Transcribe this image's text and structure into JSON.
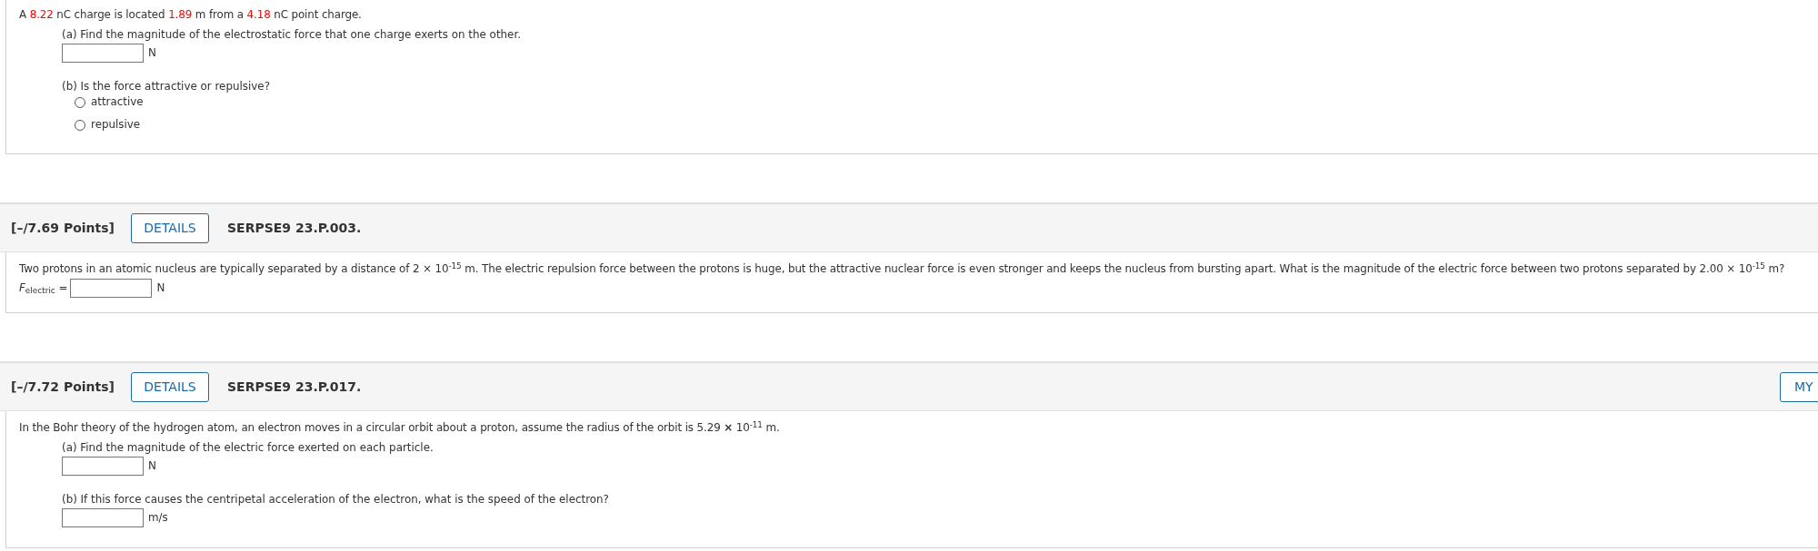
{
  "questions": [
    {
      "intro": [
        {
          "text": "A ",
          "highlight": false
        },
        {
          "text": "8.22",
          "highlight": true
        },
        {
          "text": " nC charge is located ",
          "highlight": false
        },
        {
          "text": "1.89",
          "highlight": true
        },
        {
          "text": " m from a ",
          "highlight": false
        },
        {
          "text": "4.18",
          "highlight": true
        },
        {
          "text": " nC point charge.",
          "highlight": false
        }
      ],
      "parts": [
        {
          "kind": "numeric",
          "label": "(a) Find the magnitude of the electrostatic force that one charge exerts on the other.",
          "unit": "N"
        },
        {
          "kind": "choice",
          "label": "(b) Is the force attractive or repulsive?",
          "options": [
            {
              "label": "attractive",
              "selected": false
            },
            {
              "label": "repulsive",
              "selected": false
            }
          ]
        }
      ]
    },
    {
      "header": {
        "points": "[–/7.69 Points]",
        "details": "DETAILS",
        "code": "SERPSE9 23.P.003."
      },
      "intro": [
        {
          "text": "Two protons in an atomic nucleus are typically separated by a distance of 2 × 10$^{-15}$ m. The electric repulsion force between the protons is huge, but the attractive nuclear force is even stronger and keeps the nucleus from bursting apart. What is the magnitude of the electric force between two protons separated by 2.00 × 10$^{-15}$ m?",
          "highlight": false
        }
      ],
      "parts": [
        {
          "kind": "inline",
          "prefix": "*F*$_{electric}$ =",
          "unit": "N"
        }
      ]
    },
    {
      "header": {
        "points": "[–/7.72 Points]",
        "details": "DETAILS",
        "code": "SERPSE9 23.P.017.",
        "side_button": "MY"
      },
      "intro": [
        {
          "text": "In the Bohr theory of the hydrogen atom, an electron moves in a circular orbit about a proton, assume the radius of the orbit is 5.29 **×** 10$^{-11}$ m.",
          "highlight": false
        }
      ],
      "parts": [
        {
          "kind": "numeric",
          "label": "(a) Find the magnitude of the electric force exerted on each particle.",
          "unit": "N"
        },
        {
          "kind": "numeric",
          "label": "(b) If this force causes the centripetal acceleration of the electron, what is the speed of the electron?",
          "unit": "m/s"
        }
      ]
    }
  ]
}
